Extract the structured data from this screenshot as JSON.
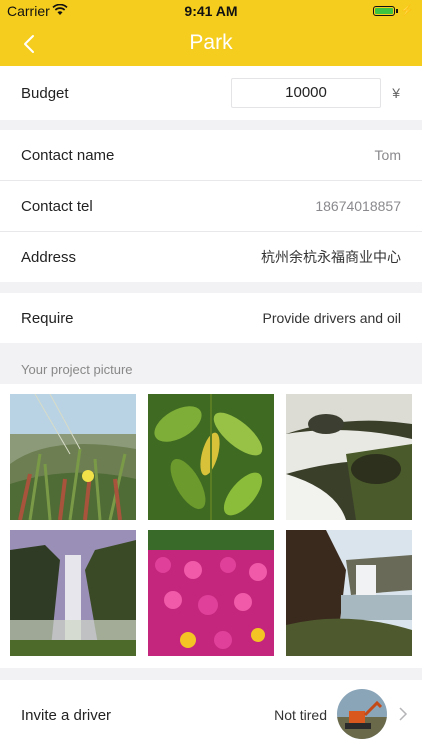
{
  "status_bar": {
    "carrier": "Carrier",
    "time": "9:41 AM"
  },
  "nav": {
    "title": "Park",
    "back_icon": "chevron-left-icon"
  },
  "form": {
    "budget": {
      "label": "Budget",
      "value": "10000",
      "currency": "¥"
    },
    "contact_name": {
      "label": "Contact name",
      "value": "Tom"
    },
    "contact_tel": {
      "label": "Contact tel",
      "value": "18674018857"
    },
    "address": {
      "label": "Address",
      "value": "杭州余杭永福商业中心"
    },
    "require": {
      "label": "Require",
      "value": "Provide drivers and oil"
    }
  },
  "gallery": {
    "caption": "Your project picture",
    "photos": [
      "flower-meadow-photo",
      "green-leaves-photo",
      "waterfall-rocks-photo",
      "waterfall-cliff-photo",
      "pink-flowers-photo",
      "waterfall-coast-photo"
    ]
  },
  "driver": {
    "label": "Invite a driver",
    "status": "Not tired",
    "avatar_icon": "excavator-avatar"
  },
  "colors": {
    "brand": "#f5cd1f",
    "background": "#f2f2f4",
    "secondary_text": "#8a8a8e"
  }
}
